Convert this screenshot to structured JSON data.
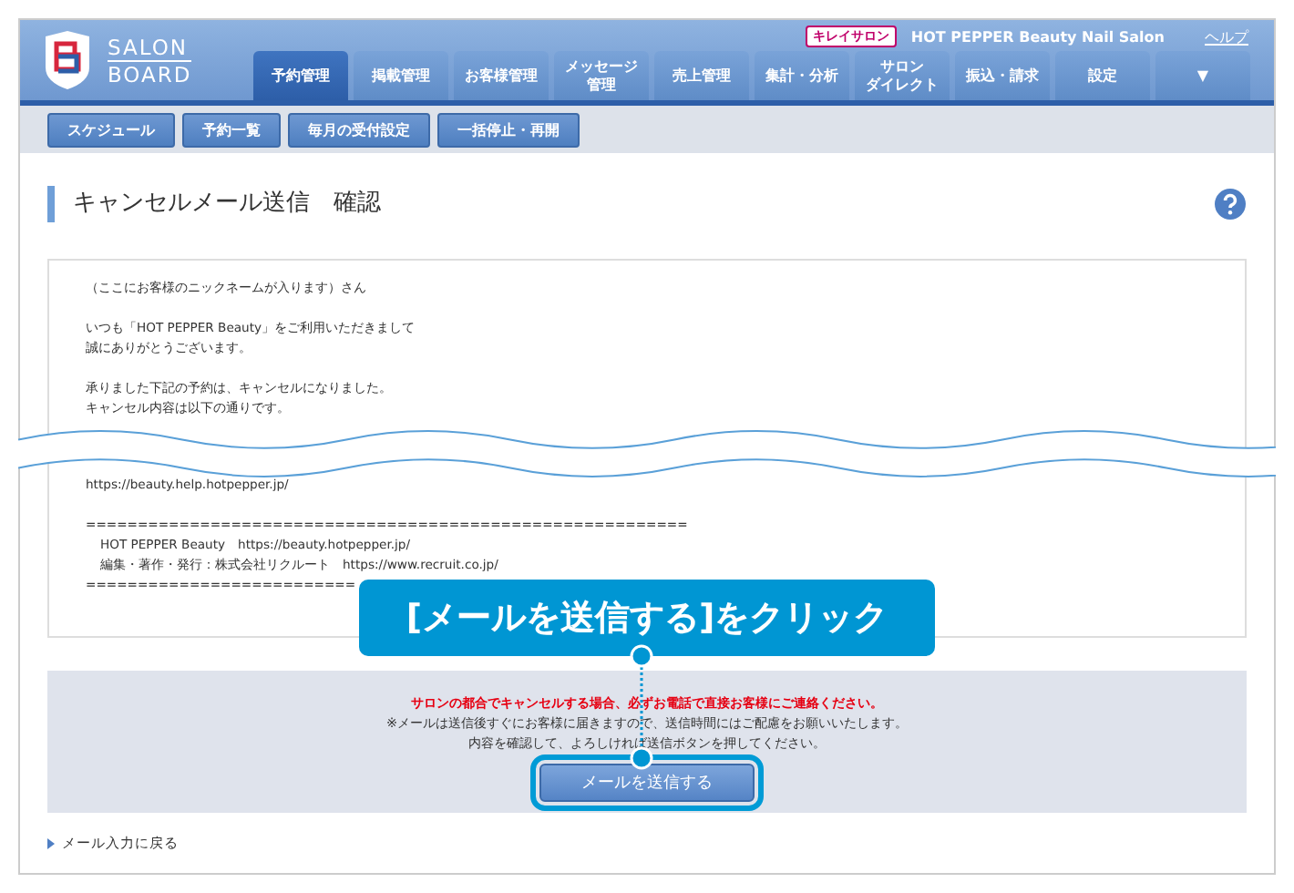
{
  "header": {
    "logo_top": "SALON",
    "logo_bottom": "BOARD",
    "badge": "キレイサロン",
    "salon_name": "HOT PEPPER Beauty Nail Salon",
    "help_link": "ヘルプ"
  },
  "tabs": [
    {
      "label": "予約管理",
      "selected": true
    },
    {
      "label": "掲載管理",
      "selected": false
    },
    {
      "label": "お客様管理",
      "selected": false
    },
    {
      "lines": [
        "メッセージ",
        "管理"
      ],
      "selected": false
    },
    {
      "label": "売上管理",
      "selected": false
    },
    {
      "label": "集計・分析",
      "selected": false
    },
    {
      "lines": [
        "サロン",
        "ダイレクト"
      ],
      "selected": false
    },
    {
      "label": "振込・請求",
      "selected": false
    },
    {
      "label": "設定",
      "selected": false
    },
    {
      "label": "▼",
      "selected": false
    }
  ],
  "subtabs": [
    "スケジュール",
    "予約一覧",
    "毎月の受付設定",
    "一括停止・再開"
  ],
  "page_title": "キャンセルメール送信　確認",
  "mail_before": [
    [
      "（ここにお客様のニックネームが入ります）さん"
    ],
    [
      "いつも「HOT PEPPER Beauty」をご利用いただきまして",
      "誠にありがとうございます。"
    ],
    [
      "承りました下記の予約は、キャンセルになりました。",
      "キャンセル内容は以下の通りです。"
    ]
  ],
  "mail_after": [
    [
      "https://beauty.help.hotpepper.jp/"
    ],
    [
      "==========================================================",
      "HOT PEPPER Beauty　https://beauty.hotpepper.jp/",
      "編集・著作・発行：株式会社リクルート　https://www.recruit.co.jp/",
      "=========================="
    ]
  ],
  "notice": {
    "warning": "サロンの都合でキャンセルする場合、必ずお電話で直接お客様にご連絡ください。",
    "lines": [
      "※メールは送信後すぐにお客様に届きますので、送信時間にはご配慮をお願いいたします。",
      "内容を確認して、よろしければ送信ボタンを押してください。"
    ]
  },
  "send_button": "メールを送信する",
  "back_link": "メール入力に戻る",
  "callout": "[メールを送信する]をクリック"
}
